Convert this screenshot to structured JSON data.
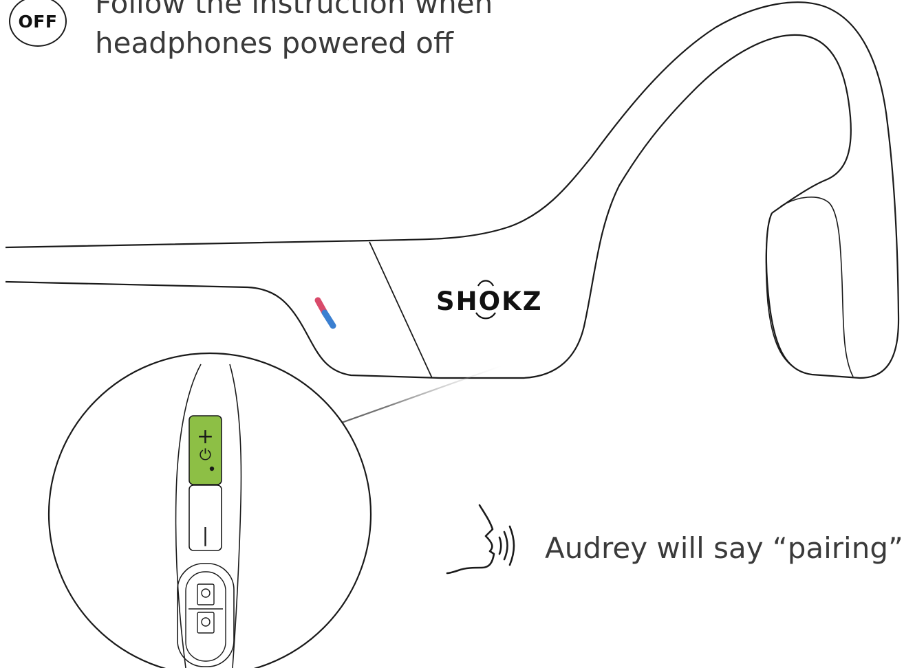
{
  "badge": {
    "label": "OFF"
  },
  "instruction": {
    "line1": "Follow the instruction when",
    "line2": "headphones powered off"
  },
  "brand": {
    "logo_text": "SHOKZ"
  },
  "button_symbols": {
    "plus": "+",
    "power": "⏻",
    "minus": "|"
  },
  "voice_prompt": {
    "text": "Audrey will say “pairing”"
  },
  "colors": {
    "button_highlight": "#8dbf45",
    "led_red": "#d94a6a",
    "led_blue": "#3b7fd0",
    "outline": "#1a1a1a",
    "text": "#3a3a3a"
  },
  "icons": [
    "speaking-head-icon",
    "power-icon",
    "plus-icon",
    "minus-icon"
  ]
}
